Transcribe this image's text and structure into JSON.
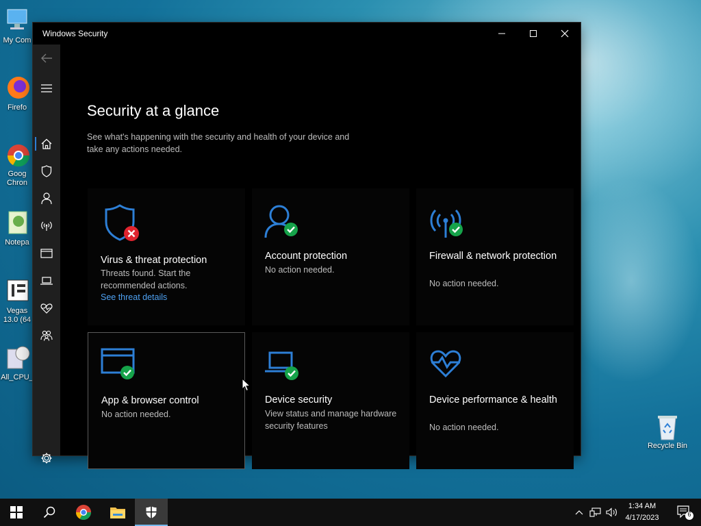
{
  "desktop": {
    "icons": [
      {
        "label": "My Com",
        "icon": "computer-icon"
      },
      {
        "label": "Firefo",
        "icon": "firefox-icon"
      },
      {
        "label": "Goog Chron",
        "icon": "chrome-icon"
      },
      {
        "label": "Notepa",
        "icon": "notepad-icon"
      },
      {
        "label": "Vegas 13.0 (64",
        "icon": "vegas-icon"
      },
      {
        "label": "All_CPU_",
        "icon": "calculator-icon"
      }
    ],
    "recycle_bin": "Recycle Bin"
  },
  "window": {
    "title": "Windows Security",
    "controls": {
      "minimize": "minimize-icon",
      "maximize": "maximize-icon",
      "close": "close-icon"
    }
  },
  "sidebar": {
    "items": [
      {
        "name": "back",
        "icon": "back-arrow-icon"
      },
      {
        "name": "menu",
        "icon": "hamburger-icon"
      },
      {
        "name": "home",
        "icon": "home-icon",
        "active": true
      },
      {
        "name": "virus",
        "icon": "shield-icon"
      },
      {
        "name": "account",
        "icon": "person-icon"
      },
      {
        "name": "firewall",
        "icon": "antenna-icon"
      },
      {
        "name": "app-browser",
        "icon": "browser-window-icon"
      },
      {
        "name": "device-security",
        "icon": "laptop-icon"
      },
      {
        "name": "performance",
        "icon": "heart-pulse-icon"
      },
      {
        "name": "family",
        "icon": "family-icon"
      },
      {
        "name": "settings",
        "icon": "gear-icon"
      }
    ]
  },
  "main": {
    "title": "Security at a glance",
    "subtitle": "See what's happening with the security and health of your device and take any actions needed.",
    "tiles": [
      {
        "title": "Virus & threat protection",
        "desc": "Threats found. Start the recommended actions.",
        "link": "See threat details",
        "status": "error"
      },
      {
        "title": "Account protection",
        "desc": "No action needed.",
        "status": "ok"
      },
      {
        "title": "Firewall & network protection",
        "desc": "No action needed.",
        "status": "ok"
      },
      {
        "title": "App & browser control",
        "desc": "No action needed.",
        "status": "ok"
      },
      {
        "title": "Device security",
        "desc": "View status and manage hardware security features",
        "status": "ok"
      },
      {
        "title": "Device performance & health",
        "desc": "No action needed.",
        "status": "none"
      }
    ]
  },
  "taskbar": {
    "time": "1:34 AM",
    "date": "4/17/2023",
    "notification_count": "6"
  },
  "colors": {
    "accent": "#2d7fd6",
    "ok": "#16a34a",
    "error": "#e0242f",
    "link": "#4ea1f2"
  }
}
